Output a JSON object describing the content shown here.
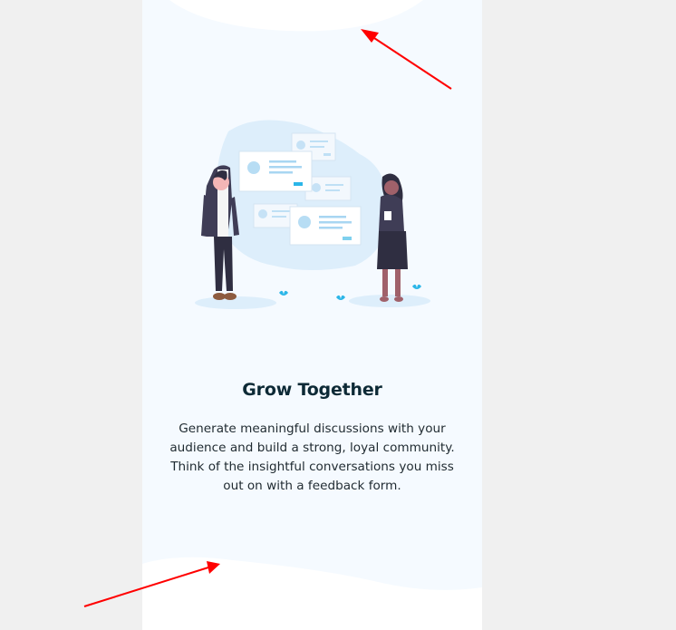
{
  "onboarding": {
    "title": "Grow Together",
    "description": "Generate meaningful discussions with your audience and build a strong, loyal community. Think of the insightful conversations you miss out on with a feedback form.",
    "illustration": "two-people-community-illustration"
  },
  "colors": {
    "page_background": "#f0f0f0",
    "screen_background": "#f5faff",
    "accent": "#2bb6e8",
    "title": "#0d2a36",
    "annotation_arrow": "#ff0000"
  }
}
